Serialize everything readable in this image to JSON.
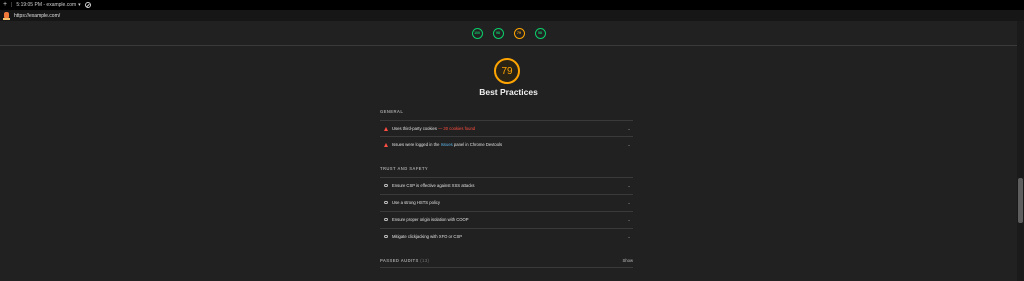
{
  "browser": {
    "tab_title": "5:19:05 PM - example.com",
    "new_tab_icon": "plus-icon",
    "url": "https://example.com/"
  },
  "score_gauges": [
    {
      "label": "100",
      "status": "pass"
    },
    {
      "label": "98",
      "status": "pass"
    },
    {
      "label": "79",
      "status": "average"
    },
    {
      "label": "58",
      "status": "pass"
    }
  ],
  "category": {
    "score": "79",
    "title": "Best Practices"
  },
  "colors": {
    "pass": "#0cce6b",
    "average": "#ffa400",
    "fail": "#ff4e42",
    "link": "#5fb4e6",
    "background": "#212121"
  },
  "sections": {
    "general": {
      "label": "GENERAL",
      "audits": [
        {
          "title": "Uses third-party cookies",
          "detail": " — 30 cookies found",
          "icon": "warning-triangle-icon"
        },
        {
          "title_prefix": "Issues were logged in the ",
          "title_link": "Issues",
          "title_suffix": " panel in Chrome Devtools",
          "icon": "warning-triangle-icon"
        }
      ]
    },
    "trust": {
      "label": "TRUST AND SAFETY",
      "audits": [
        {
          "title": "Ensure CSP is effective against XSS attacks",
          "icon": "circle-icon"
        },
        {
          "title": "Use a strong HSTS policy",
          "icon": "circle-icon"
        },
        {
          "title": "Ensure proper origin isolation with COOP",
          "icon": "circle-icon"
        },
        {
          "title": "Mitigate clickjacking with XFO or CSP",
          "icon": "circle-icon"
        }
      ]
    }
  },
  "passed_audits": {
    "label": "PASSED AUDITS",
    "count": "(13)",
    "toggle": "Show"
  }
}
